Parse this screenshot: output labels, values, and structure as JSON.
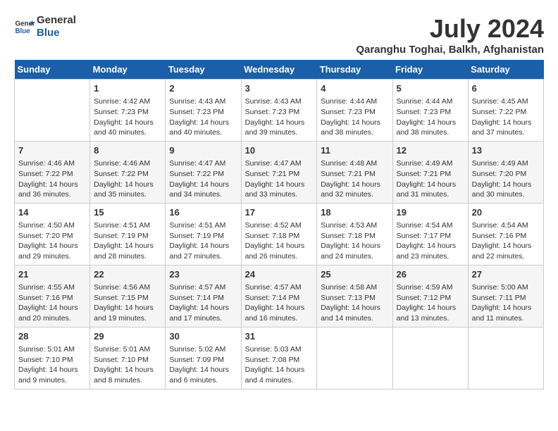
{
  "header": {
    "logo_line1": "General",
    "logo_line2": "Blue",
    "month": "July 2024",
    "location": "Qaranghu Toghai, Balkh, Afghanistan"
  },
  "days_of_week": [
    "Sunday",
    "Monday",
    "Tuesday",
    "Wednesday",
    "Thursday",
    "Friday",
    "Saturday"
  ],
  "weeks": [
    [
      {
        "day": "",
        "content": ""
      },
      {
        "day": "1",
        "content": "Sunrise: 4:42 AM\nSunset: 7:23 PM\nDaylight: 14 hours\nand 40 minutes."
      },
      {
        "day": "2",
        "content": "Sunrise: 4:43 AM\nSunset: 7:23 PM\nDaylight: 14 hours\nand 40 minutes."
      },
      {
        "day": "3",
        "content": "Sunrise: 4:43 AM\nSunset: 7:23 PM\nDaylight: 14 hours\nand 39 minutes."
      },
      {
        "day": "4",
        "content": "Sunrise: 4:44 AM\nSunset: 7:23 PM\nDaylight: 14 hours\nand 38 minutes."
      },
      {
        "day": "5",
        "content": "Sunrise: 4:44 AM\nSunset: 7:23 PM\nDaylight: 14 hours\nand 38 minutes."
      },
      {
        "day": "6",
        "content": "Sunrise: 4:45 AM\nSunset: 7:22 PM\nDaylight: 14 hours\nand 37 minutes."
      }
    ],
    [
      {
        "day": "7",
        "content": "Sunrise: 4:46 AM\nSunset: 7:22 PM\nDaylight: 14 hours\nand 36 minutes."
      },
      {
        "day": "8",
        "content": "Sunrise: 4:46 AM\nSunset: 7:22 PM\nDaylight: 14 hours\nand 35 minutes."
      },
      {
        "day": "9",
        "content": "Sunrise: 4:47 AM\nSunset: 7:22 PM\nDaylight: 14 hours\nand 34 minutes."
      },
      {
        "day": "10",
        "content": "Sunrise: 4:47 AM\nSunset: 7:21 PM\nDaylight: 14 hours\nand 33 minutes."
      },
      {
        "day": "11",
        "content": "Sunrise: 4:48 AM\nSunset: 7:21 PM\nDaylight: 14 hours\nand 32 minutes."
      },
      {
        "day": "12",
        "content": "Sunrise: 4:49 AM\nSunset: 7:21 PM\nDaylight: 14 hours\nand 31 minutes."
      },
      {
        "day": "13",
        "content": "Sunrise: 4:49 AM\nSunset: 7:20 PM\nDaylight: 14 hours\nand 30 minutes."
      }
    ],
    [
      {
        "day": "14",
        "content": "Sunrise: 4:50 AM\nSunset: 7:20 PM\nDaylight: 14 hours\nand 29 minutes."
      },
      {
        "day": "15",
        "content": "Sunrise: 4:51 AM\nSunset: 7:19 PM\nDaylight: 14 hours\nand 28 minutes."
      },
      {
        "day": "16",
        "content": "Sunrise: 4:51 AM\nSunset: 7:19 PM\nDaylight: 14 hours\nand 27 minutes."
      },
      {
        "day": "17",
        "content": "Sunrise: 4:52 AM\nSunset: 7:18 PM\nDaylight: 14 hours\nand 26 minutes."
      },
      {
        "day": "18",
        "content": "Sunrise: 4:53 AM\nSunset: 7:18 PM\nDaylight: 14 hours\nand 24 minutes."
      },
      {
        "day": "19",
        "content": "Sunrise: 4:54 AM\nSunset: 7:17 PM\nDaylight: 14 hours\nand 23 minutes."
      },
      {
        "day": "20",
        "content": "Sunrise: 4:54 AM\nSunset: 7:16 PM\nDaylight: 14 hours\nand 22 minutes."
      }
    ],
    [
      {
        "day": "21",
        "content": "Sunrise: 4:55 AM\nSunset: 7:16 PM\nDaylight: 14 hours\nand 20 minutes."
      },
      {
        "day": "22",
        "content": "Sunrise: 4:56 AM\nSunset: 7:15 PM\nDaylight: 14 hours\nand 19 minutes."
      },
      {
        "day": "23",
        "content": "Sunrise: 4:57 AM\nSunset: 7:14 PM\nDaylight: 14 hours\nand 17 minutes."
      },
      {
        "day": "24",
        "content": "Sunrise: 4:57 AM\nSunset: 7:14 PM\nDaylight: 14 hours\nand 16 minutes."
      },
      {
        "day": "25",
        "content": "Sunrise: 4:58 AM\nSunset: 7:13 PM\nDaylight: 14 hours\nand 14 minutes."
      },
      {
        "day": "26",
        "content": "Sunrise: 4:59 AM\nSunset: 7:12 PM\nDaylight: 14 hours\nand 13 minutes."
      },
      {
        "day": "27",
        "content": "Sunrise: 5:00 AM\nSunset: 7:11 PM\nDaylight: 14 hours\nand 11 minutes."
      }
    ],
    [
      {
        "day": "28",
        "content": "Sunrise: 5:01 AM\nSunset: 7:10 PM\nDaylight: 14 hours\nand 9 minutes."
      },
      {
        "day": "29",
        "content": "Sunrise: 5:01 AM\nSunset: 7:10 PM\nDaylight: 14 hours\nand 8 minutes."
      },
      {
        "day": "30",
        "content": "Sunrise: 5:02 AM\nSunset: 7:09 PM\nDaylight: 14 hours\nand 6 minutes."
      },
      {
        "day": "31",
        "content": "Sunrise: 5:03 AM\nSunset: 7:08 PM\nDaylight: 14 hours\nand 4 minutes."
      },
      {
        "day": "",
        "content": ""
      },
      {
        "day": "",
        "content": ""
      },
      {
        "day": "",
        "content": ""
      }
    ]
  ]
}
